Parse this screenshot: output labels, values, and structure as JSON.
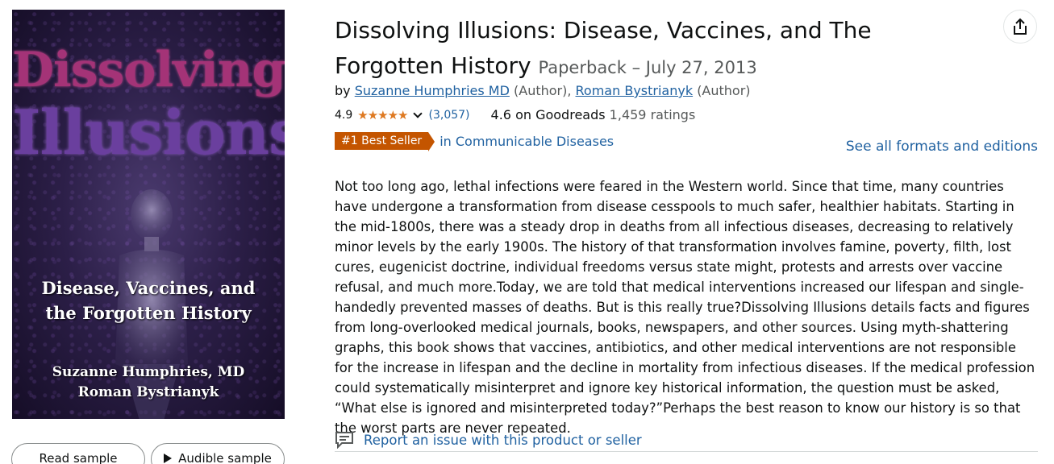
{
  "cover": {
    "title_line1": "Dissolving",
    "title_line2": "Illusions",
    "subtitle_line1": "Disease, Vaccines, and",
    "subtitle_line2": "the Forgotten History",
    "author_line1": "Suzanne Humphries, MD",
    "author_line2": "Roman Bystrianyk"
  },
  "samples": {
    "read_label": "Read sample",
    "audible_label": "Audible sample"
  },
  "product": {
    "title": "Dissolving Illusions: Disease, Vaccines, and The Forgotten History",
    "format": "Paperback – July 27, 2013",
    "by_label": "by",
    "authors": [
      {
        "name": "Suzanne Humphries MD",
        "role": "(Author),"
      },
      {
        "name": "Roman Bystrianyk",
        "role": "(Author)"
      }
    ],
    "rating": "4.9",
    "stars": "★★★★★",
    "rating_count": "(3,057)",
    "goodreads_rating": "4.6 on Goodreads",
    "goodreads_count": "1,459 ratings",
    "badge": "#1 Best Seller",
    "badge_category": "in Communicable Diseases",
    "see_all": "See all formats and editions",
    "description": "Not too long ago, lethal infections were feared in the Western world. Since that time, many countries have undergone a transformation from disease cesspools to much safer, healthier habitats. Starting in the mid-1800s, there was a steady drop in deaths from all infectious diseases, decreasing to relatively minor levels by the early 1900s. The history of that transformation involves famine, poverty, filth, lost cures, eugenicist doctrine, individual freedoms versus state might, protests and arrests over vaccine refusal, and much more.Today, we are told that medical interventions increased our lifespan and single-handedly prevented masses of deaths. But is this really true?Dissolving Illusions details facts and figures from long-overlooked medical journals, books, newspapers, and other sources. Using myth-shattering graphs, this book shows that vaccines, antibiotics, and other medical interventions are not responsible for the increase in lifespan and the decline in mortality from infectious diseases. If the medical profession could systematically misinterpret and ignore key historical information, the question must be asked, “What else is ignored and misinterpreted today?”Perhaps the best reason to know our history is so that the worst parts are never repeated.",
    "report_label": "Report an issue with this product or seller"
  },
  "colors": {
    "link": "#2162a1",
    "star": "#de7921",
    "badge": "#c45500"
  }
}
